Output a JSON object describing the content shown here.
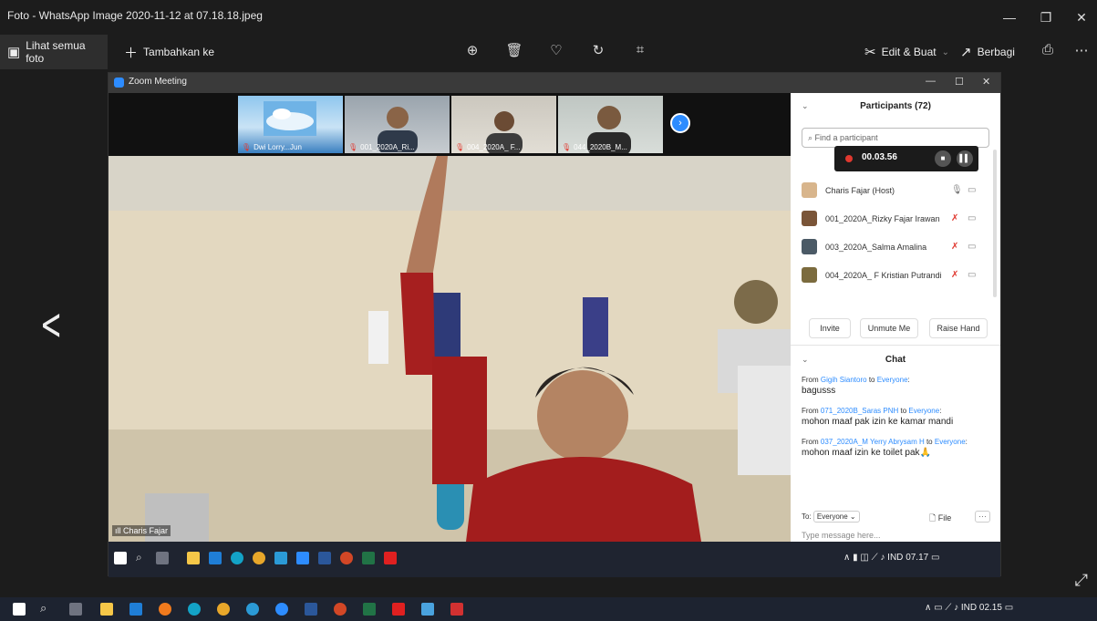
{
  "window": {
    "title": "Foto - WhatsApp Image 2020-11-12 at 07.18.18.jpeg",
    "controls": {
      "minimize": "—",
      "restore": "❐",
      "close": "✕"
    }
  },
  "toolbar": {
    "see_all_label": "Lihat semua foto",
    "add_to_label": "Tambahkan ke",
    "edit_create_label": "Edit & Buat",
    "share_label": "Berbagi",
    "icons": [
      "zoom-in-icon",
      "trash-icon",
      "heart-icon",
      "rotate-icon",
      "crop-icon"
    ]
  },
  "zoom": {
    "title": "Zoom Meeting",
    "thumbnails": [
      {
        "name": "Dwi Lorry...Jun"
      },
      {
        "name": "001_2020A_Ri..."
      },
      {
        "name": "004_2020A_ F..."
      },
      {
        "name": "044_2020B_M..."
      }
    ],
    "speaker_name": "Charis Fajar",
    "participants_title": "Participants (72)",
    "search_placeholder": "Find a participant",
    "recording_time": "00.03.56",
    "participants": [
      {
        "name": "Charis Fajar (Host)",
        "mic_muted": false
      },
      {
        "name": "001_2020A_Rizky Fajar Irawan",
        "mic_muted": true
      },
      {
        "name": "003_2020A_Salma Amalina",
        "mic_muted": true
      },
      {
        "name": "004_2020A_ F Kristian Putrandi",
        "mic_muted": true
      }
    ],
    "buttons": {
      "invite": "Invite",
      "unmute": "Unmute Me",
      "raise_hand": "Raise Hand"
    },
    "chat_title": "Chat",
    "chat": [
      {
        "from": "Gigih Siantoro",
        "to": "Everyone",
        "message": "bagusss"
      },
      {
        "from": "071_2020B_Saras PNH",
        "to": "Everyone",
        "message": "mohon maaf pak izin ke kamar mandi"
      },
      {
        "from": "037_2020A_M Yerry Abrysam H",
        "to": "Everyone",
        "message": "mohon maaf izin ke toilet pak🙏"
      }
    ],
    "chat_to_label": "To:",
    "chat_to_value": "Everyone",
    "file_label": "File",
    "type_placeholder": "Type message here...",
    "inner_tray": {
      "lang": "IND",
      "time": "07.17"
    }
  },
  "taskbar": {
    "lang": "IND",
    "time": "02.15"
  },
  "colors": {
    "accent": "#2d8cff",
    "muted": "#e0382f"
  }
}
